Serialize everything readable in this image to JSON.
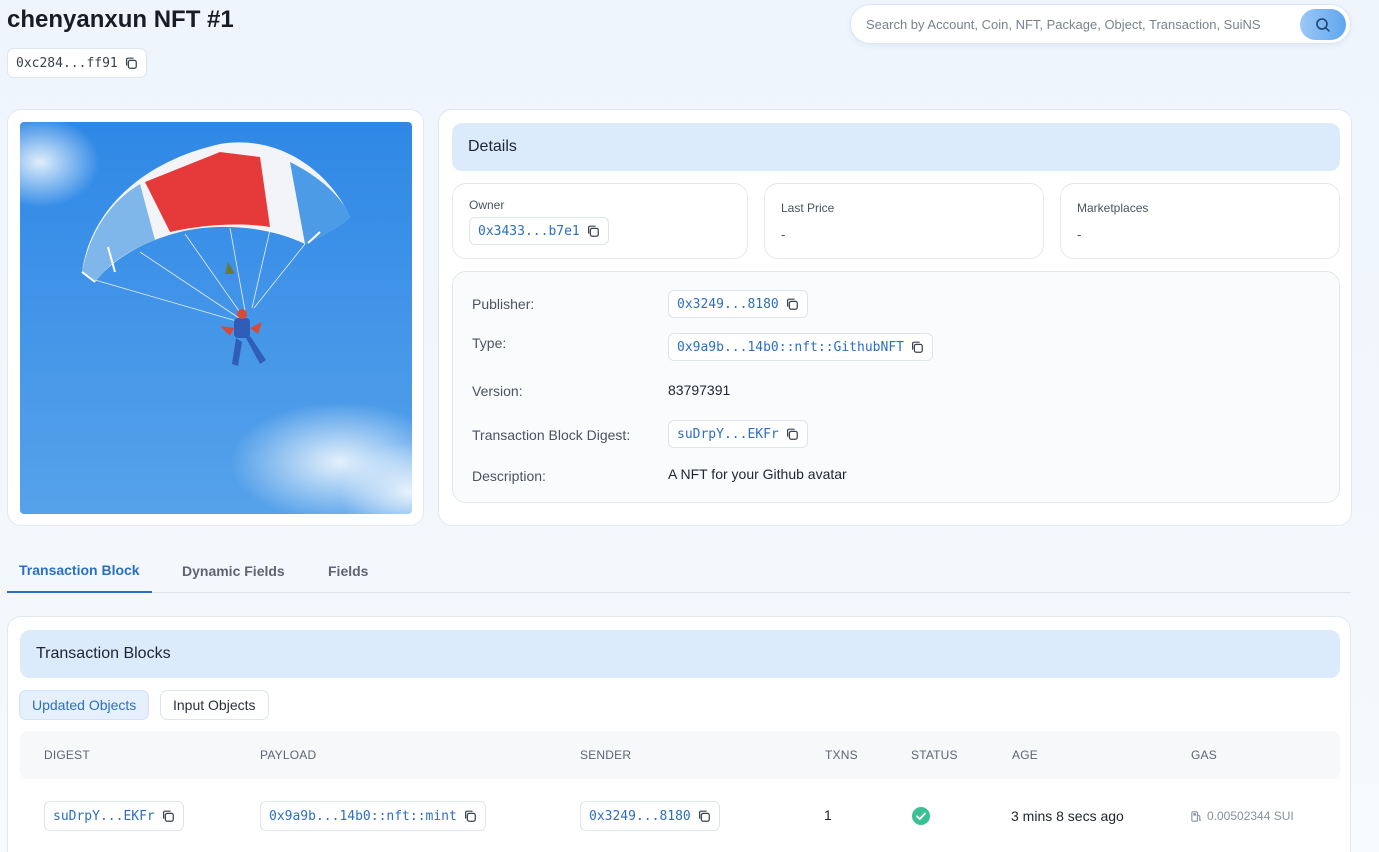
{
  "page": {
    "title": "chenyanxun NFT #1",
    "object_id": "0xc284...ff91"
  },
  "search": {
    "placeholder": "Search by Account, Coin, NFT, Package, Object, Transaction, SuiNS"
  },
  "details": {
    "header": "Details",
    "owner": {
      "label": "Owner",
      "value": "0x3433...b7e1"
    },
    "last_price": {
      "label": "Last Price",
      "value": "-"
    },
    "marketplaces": {
      "label": "Marketplaces",
      "value": "-"
    },
    "props": [
      {
        "label": "Publisher:",
        "value": "0x3249...8180"
      },
      {
        "label": "Type:",
        "value": "0x9a9b...14b0::nft::GithubNFT"
      },
      {
        "label": "Version:",
        "value": "83797391"
      },
      {
        "label": "Transaction Block Digest:",
        "value": "suDrpY...EKFr"
      },
      {
        "label": "Description:",
        "value": "A NFT for your Github avatar"
      }
    ]
  },
  "tabs": [
    "Transaction Block",
    "Dynamic Fields",
    "Fields"
  ],
  "tx": {
    "header": "Transaction Blocks",
    "filters": [
      "Updated Objects",
      "Input Objects"
    ],
    "columns": [
      "DIGEST",
      "PAYLOAD",
      "SENDER",
      "TXNS",
      "STATUS",
      "AGE",
      "GAS"
    ],
    "rows": [
      {
        "digest": "suDrpY...EKFr",
        "payload": "0x9a9b...14b0::nft::mint",
        "sender": "0x3249...8180",
        "txns": "1",
        "status": "success",
        "age": "3 mins 8 secs ago",
        "gas": "0.00502344 SUI"
      }
    ]
  },
  "colors": {
    "accent": "#2a6fc2",
    "header_bg": "#dcebfc",
    "success": "#3cbf95"
  }
}
